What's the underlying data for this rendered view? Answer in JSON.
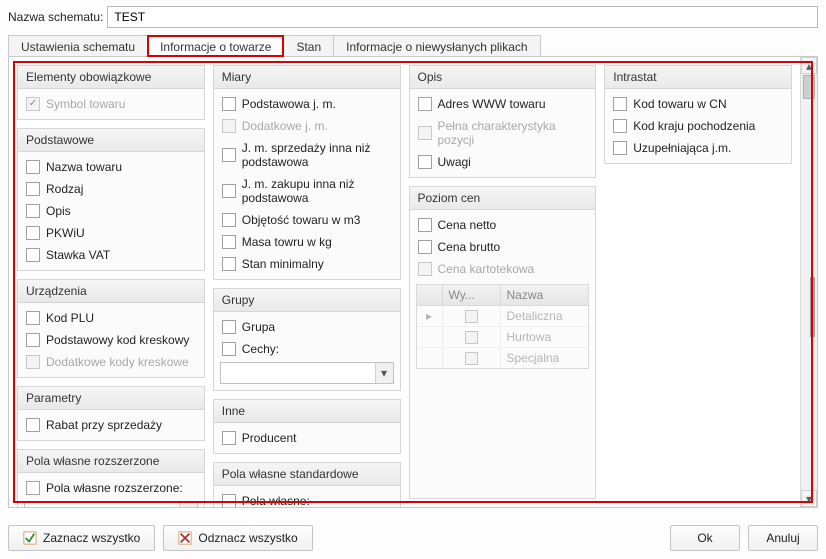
{
  "top": {
    "label": "Nazwa schematu:",
    "value": "TEST"
  },
  "tabs": {
    "t0": "Ustawienia schematu",
    "t1": "Informacje o towarze",
    "t2": "Stan",
    "t3": "Informacje o niewysłanych plikach"
  },
  "groups": {
    "elObow": {
      "title": "Elementy obowiązkowe",
      "items": {
        "symbol": "Symbol towaru"
      }
    },
    "podst": {
      "title": "Podstawowe",
      "items": {
        "nazwa": "Nazwa towaru",
        "rodzaj": "Rodzaj",
        "opis": "Opis",
        "pkwiu": "PKWiU",
        "vat": "Stawka VAT"
      }
    },
    "urz": {
      "title": "Urządzenia",
      "items": {
        "kodplu": "Kod PLU",
        "pkk": "Podstawowy kod kreskowy",
        "dkk": "Dodatkowe kody kreskowe"
      }
    },
    "param": {
      "title": "Parametry",
      "items": {
        "rabat": "Rabat przy sprzedaży"
      }
    },
    "pwr": {
      "title": "Pola własne rozszerzone",
      "items": {
        "pwr": "Pola własne rozszerzone:"
      }
    },
    "miary": {
      "title": "Miary",
      "items": {
        "pjm": "Podstawowa j. m.",
        "djm": "Dodatkowe j. m.",
        "jms": "J. m. sprzedaży inna niż podstawowa",
        "jmz": "J. m. zakupu inna niż podstawowa",
        "obj": "Objętość towaru w m3",
        "masa": "Masa towru w kg",
        "stan": "Stan minimalny"
      }
    },
    "grupy": {
      "title": "Grupy",
      "items": {
        "grupa": "Grupa",
        "cechy": "Cechy:"
      }
    },
    "inne": {
      "title": "Inne",
      "items": {
        "prod": "Producent"
      }
    },
    "pws": {
      "title": "Pola własne standardowe",
      "items": {
        "pw": "Pola własne:"
      }
    },
    "opis2": {
      "title": "Opis",
      "items": {
        "www": "Adres WWW towaru",
        "pelna": "Pełna charakterystyka pozycji",
        "uwagi": "Uwagi"
      }
    },
    "poziom": {
      "title": "Poziom cen",
      "items": {
        "netto": "Cena netto",
        "brutto": "Cena brutto",
        "kart": "Cena kartotekowa"
      },
      "table": {
        "h1": "Wy...",
        "h2": "Nazwa",
        "rows": {
          "r0": "Detaliczna",
          "r1": "Hurtowa",
          "r2": "Specjalna"
        }
      }
    },
    "intra": {
      "title": "Intrastat",
      "items": {
        "kodcn": "Kod towaru w CN",
        "kraj": "Kod kraju pochodzenia",
        "uzup": "Uzupełniająca j.m."
      }
    }
  },
  "footer": {
    "selectAll": "Zaznacz wszystko",
    "deselectAll": "Odznacz wszystko",
    "ok": "Ok",
    "cancel": "Anuluj"
  }
}
